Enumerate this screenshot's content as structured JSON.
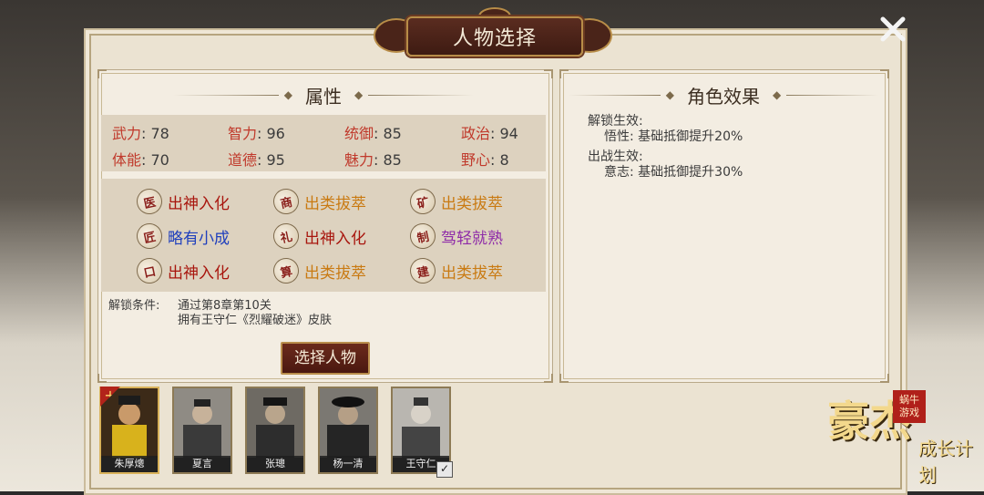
{
  "dialog": {
    "title": "人物选择"
  },
  "attributes": {
    "heading": "属性",
    "stats": [
      {
        "label": "武力",
        "value": "78"
      },
      {
        "label": "智力",
        "value": "96"
      },
      {
        "label": "统御",
        "value": "85"
      },
      {
        "label": "政治",
        "value": "94"
      },
      {
        "label": "体能",
        "value": "70"
      },
      {
        "label": "道德",
        "value": "95"
      },
      {
        "label": "魅力",
        "value": "85"
      },
      {
        "label": "野心",
        "value": "8"
      }
    ],
    "separator": ": "
  },
  "skills": [
    {
      "icon": "医",
      "icon_name": "skill-seal-icon",
      "level": "出神入化",
      "color": "red"
    },
    {
      "icon": "商",
      "icon_name": "skill-seal-icon",
      "level": "出类拔萃",
      "color": "orange"
    },
    {
      "icon": "矿",
      "icon_name": "skill-seal-icon",
      "level": "出类拔萃",
      "color": "orange"
    },
    {
      "icon": "匠",
      "icon_name": "skill-seal-icon",
      "level": "略有小成",
      "color": "blue"
    },
    {
      "icon": "礼",
      "icon_name": "skill-seal-icon",
      "level": "出神入化",
      "color": "red"
    },
    {
      "icon": "制",
      "icon_name": "skill-seal-icon",
      "level": "驾轻就熟",
      "color": "purple"
    },
    {
      "icon": "口",
      "icon_name": "skill-seal-icon",
      "level": "出神入化",
      "color": "red"
    },
    {
      "icon": "算",
      "icon_name": "skill-seal-icon",
      "level": "出类拔萃",
      "color": "orange"
    },
    {
      "icon": "建",
      "icon_name": "skill-seal-icon",
      "level": "出类拔萃",
      "color": "orange"
    }
  ],
  "unlock": {
    "label": "解锁条件:",
    "line1": "通过第8章第10关",
    "line2": "拥有王守仁《烈耀破迷》皮肤"
  },
  "select_button": "选择人物",
  "effects": {
    "heading": "角色效果",
    "unlock_title": "解锁生效:",
    "unlock_value": "悟性:  基础抵御提升20%",
    "battle_title": "出战生效:",
    "battle_value": "意志:  基础抵御提升30%"
  },
  "characters": [
    {
      "name": "朱厚熜"
    },
    {
      "name": "夏言"
    },
    {
      "name": "张璁"
    },
    {
      "name": "杨一清"
    },
    {
      "name": "王守仁"
    }
  ],
  "brand": {
    "main": "豪杰",
    "sub": "成长计划",
    "stamp": "蜗牛游戏"
  },
  "colors": {
    "level_red": "#a8150d",
    "level_orange": "#c97a12",
    "level_blue": "#1f3fbd",
    "level_purple": "#8e2aa8",
    "stat_label": "#c0392b",
    "button_bg": "#5a2116"
  }
}
